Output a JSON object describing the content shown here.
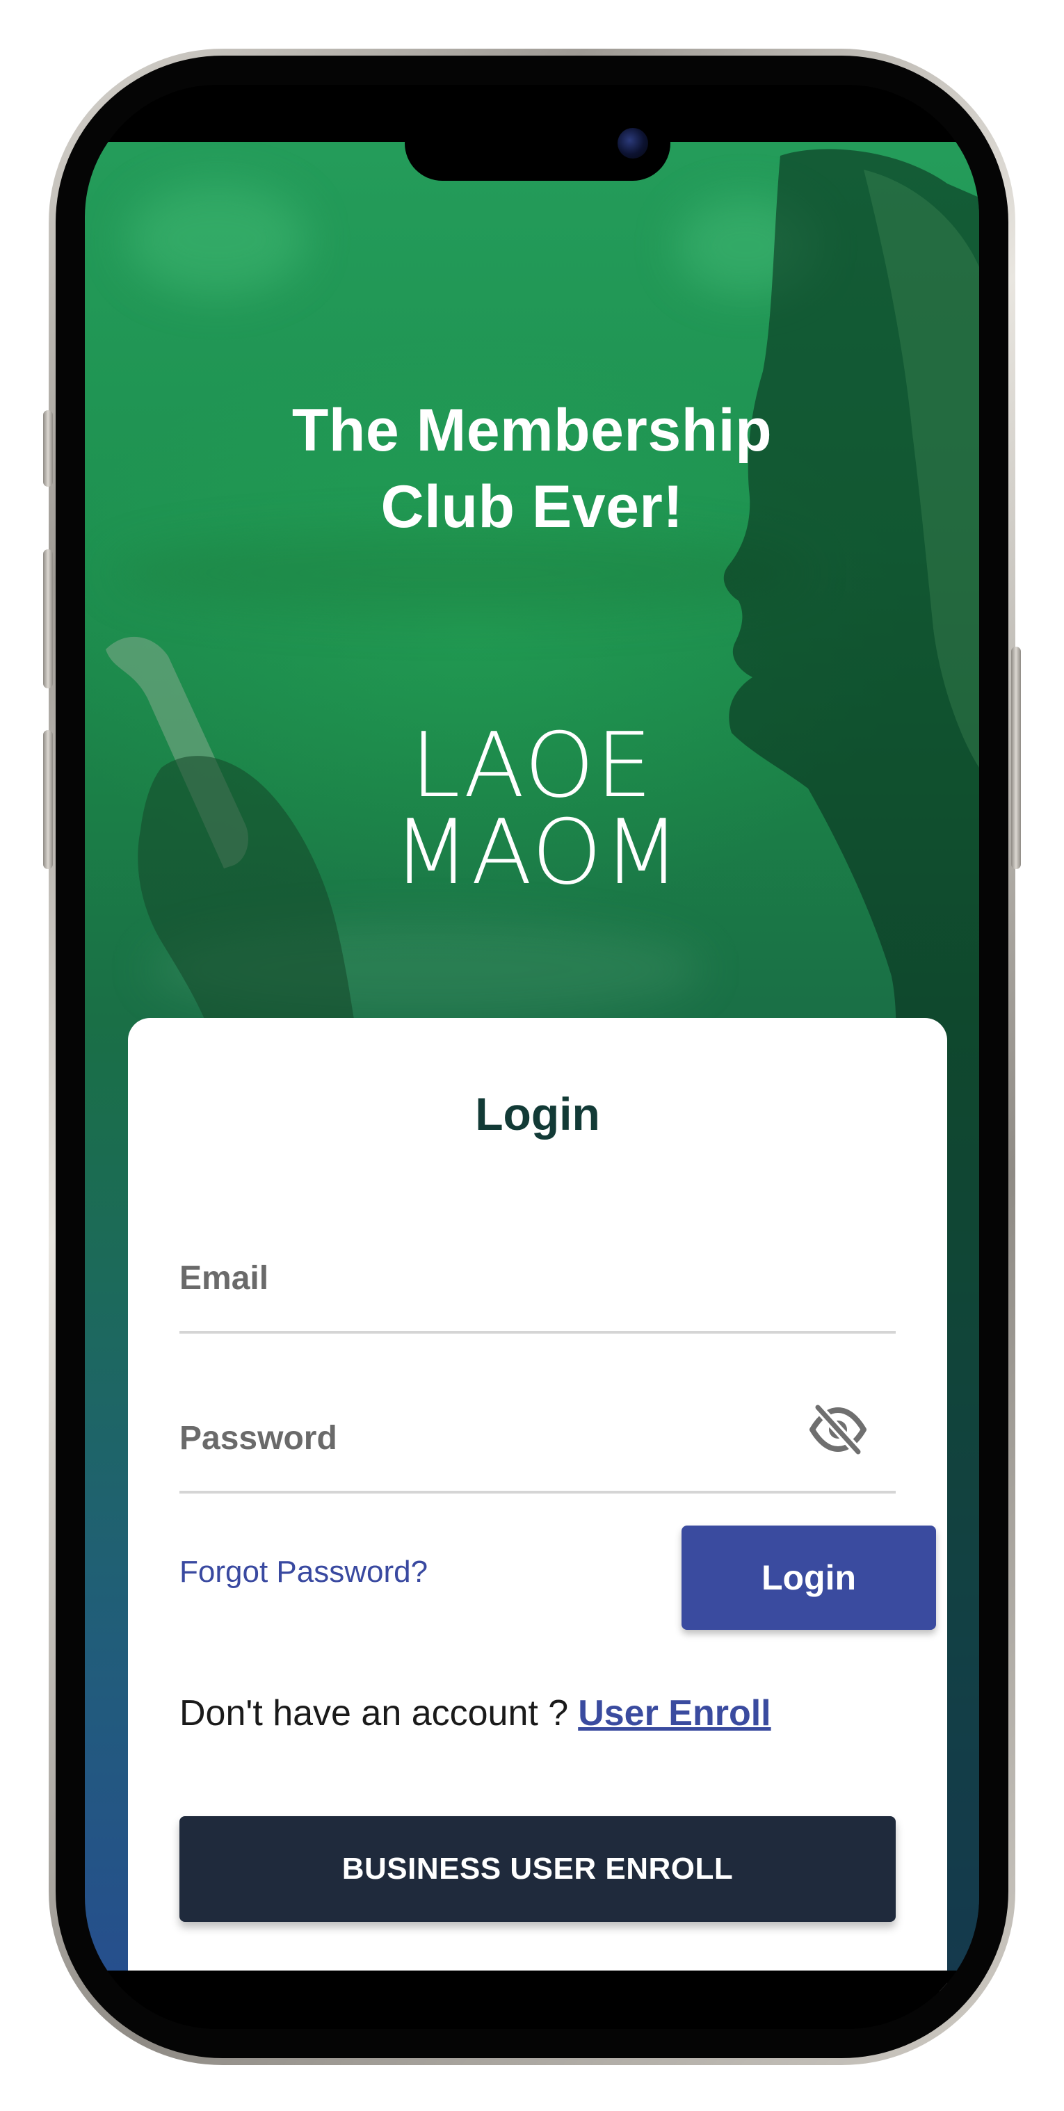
{
  "hero": {
    "headline_line1": "The Membership",
    "headline_line2": "Club Ever!",
    "logo_line1": "LAOE",
    "logo_line2": "MAOM"
  },
  "login_card": {
    "title": "Login",
    "email_placeholder": "Email",
    "email_value": "",
    "password_placeholder": "Password",
    "password_value": "",
    "password_toggle_icon": "eye-slash-icon",
    "forgot_password_label": "Forgot Password?",
    "login_button_label": "Login",
    "enroll_prompt": "Don't have an account ?",
    "user_enroll_label": "User Enroll",
    "business_enroll_label": "BUSINESS USER ENROLL"
  },
  "colors": {
    "primary_button": "#3a4b9f",
    "dark_button": "#1f2a3c",
    "title_text": "#123a36",
    "hero_green": "#1e9150",
    "hero_blue": "#264f8d"
  }
}
